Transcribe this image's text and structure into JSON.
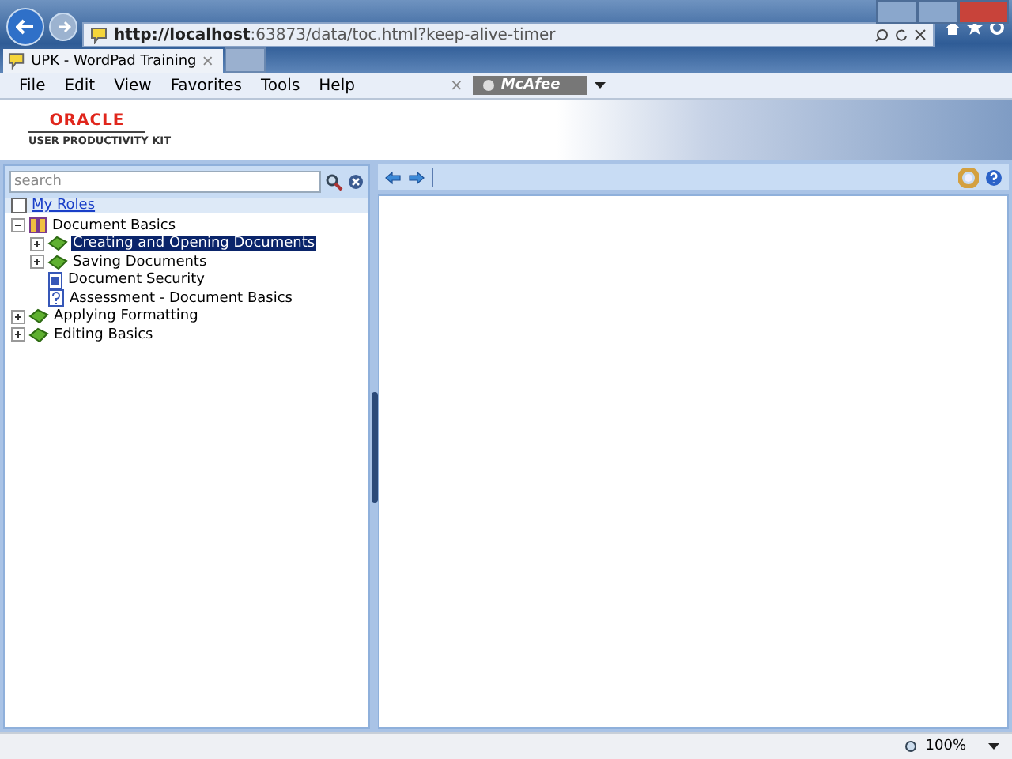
{
  "browser": {
    "url_host": "http://localhost",
    "url_rest": ":63873/data/toc.html?keep-alive-timer",
    "tab_title": "UPK - WordPad Training",
    "menu": [
      "File",
      "Edit",
      "View",
      "Favorites",
      "Tools",
      "Help"
    ],
    "toolbar_close": "×",
    "mcafee": "McAfee"
  },
  "header": {
    "logo": "ORACLE",
    "subtitle": "USER PRODUCTIVITY KIT"
  },
  "sidebar": {
    "search_placeholder": "search",
    "my_roles": {
      "label": "My Roles",
      "checked": false
    },
    "tree": [
      {
        "label": "Document Basics",
        "kind": "module",
        "expanded": true,
        "selected": false,
        "children": [
          {
            "label": "Creating and Opening Documents",
            "kind": "section",
            "expanded": false,
            "selected": true
          },
          {
            "label": "Saving Documents",
            "kind": "section",
            "expanded": false,
            "selected": false
          },
          {
            "label": "Document Security",
            "kind": "document",
            "selected": false
          },
          {
            "label": "Assessment - Document Basics",
            "kind": "assessment",
            "selected": false
          }
        ]
      },
      {
        "label": "Applying Formatting",
        "kind": "section",
        "expanded": false,
        "selected": false
      },
      {
        "label": "Editing Basics",
        "kind": "section",
        "expanded": false,
        "selected": false
      }
    ]
  },
  "status_bar": {
    "zoom": "100%"
  }
}
